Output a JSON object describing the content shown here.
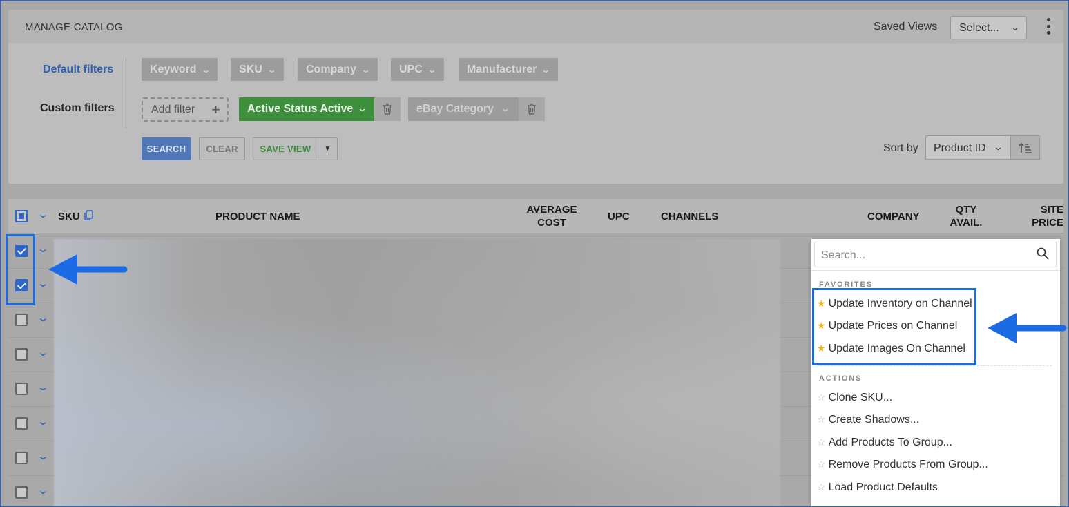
{
  "header": {
    "title": "MANAGE CATALOG",
    "saved_views_label": "Saved Views",
    "saved_views_value": "Select..."
  },
  "filters": {
    "default_label": "Default filters",
    "custom_label": "Custom filters",
    "default_chips": [
      "Keyword",
      "SKU",
      "Company",
      "UPC",
      "Manufacturer"
    ],
    "add_filter_label": "Add filter",
    "active_filter_name": "Active Status",
    "active_filter_value": "Active",
    "ebay_filter_label": "eBay Category"
  },
  "actions": {
    "search": "SEARCH",
    "clear": "CLEAR",
    "save_view": "SAVE VIEW",
    "sort_label": "Sort by",
    "sort_value": "Product ID"
  },
  "table": {
    "columns": {
      "sku": "SKU",
      "product_name": "PRODUCT NAME",
      "average_cost_1": "AVERAGE",
      "average_cost_2": "COST",
      "upc": "UPC",
      "channels": "CHANNELS",
      "company": "COMPANY",
      "qty_1": "QTY",
      "qty_2": "AVAIL.",
      "site_1": "SITE",
      "site_2": "PRICE"
    },
    "rows_checked": [
      true,
      true,
      false,
      false,
      false,
      false,
      false,
      false
    ]
  },
  "menu": {
    "search_placeholder": "Search...",
    "favorites_label": "FAVORITES",
    "favorites": [
      "Update Inventory on Channel",
      "Update Prices on Channel",
      "Update Images On Channel"
    ],
    "actions_label": "ACTIONS",
    "actions": [
      "Clone SKU...",
      "Create Shadows...",
      "Add Products To Group...",
      "Remove Products From Group...",
      "Load Product Defaults"
    ]
  },
  "colors": {
    "accent_blue": "#1d6ae5",
    "active_green": "#3d8f3b",
    "favorite_star": "#f2b01e"
  }
}
